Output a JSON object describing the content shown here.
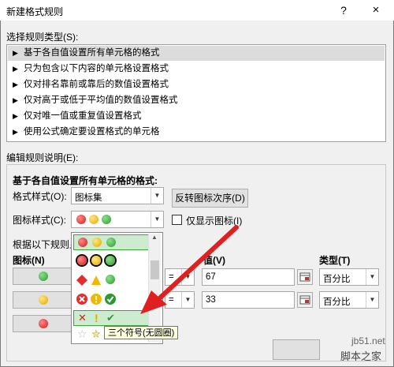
{
  "window": {
    "title": "新建格式规则",
    "help": "?",
    "close": "×"
  },
  "rule_type_section": {
    "label": "选择规则类型(S):"
  },
  "rule_types": [
    "基于各自值设置所有单元格的格式",
    "只为包含以下内容的单元格设置格式",
    "仅对排名靠前或靠后的数值设置格式",
    "仅对高于或低于平均值的数值设置格式",
    "仅对唯一值或重复值设置格式",
    "使用公式确定要设置格式的单元格"
  ],
  "rule_desc_section": {
    "label": "编辑规则说明(E):"
  },
  "desc": {
    "heading": "基于各自值设置所有单元格的格式:",
    "format_style_label": "格式样式(O):",
    "format_style_value": "图标集",
    "reverse_button": "反转图标次序(D)",
    "icon_style_label": "图标样式(C):",
    "show_icon_only_label": "仅显示图标(I)",
    "rule_label_partial": "根据以下规则显",
    "icon_col_header": "图标(N)",
    "value_col_header": "值(V)",
    "type_col_header": "类型(T)",
    "rows": [
      {
        "op": "=",
        "value": "67",
        "type": "百分比"
      },
      {
        "op": "=",
        "value": "33",
        "type": "百分比"
      }
    ]
  },
  "popup": {
    "tooltip": "三个符号(无圆圈)",
    "symbol_x": "✕",
    "symbol_excl": "!",
    "symbol_check": "✔"
  },
  "watermark": {
    "line1": "jb51.net",
    "line2": "脚本之家"
  },
  "colors": {
    "highlight_border": "#3aa33a",
    "arrow": "#e02020",
    "selected_row": "#dcdcdc"
  }
}
